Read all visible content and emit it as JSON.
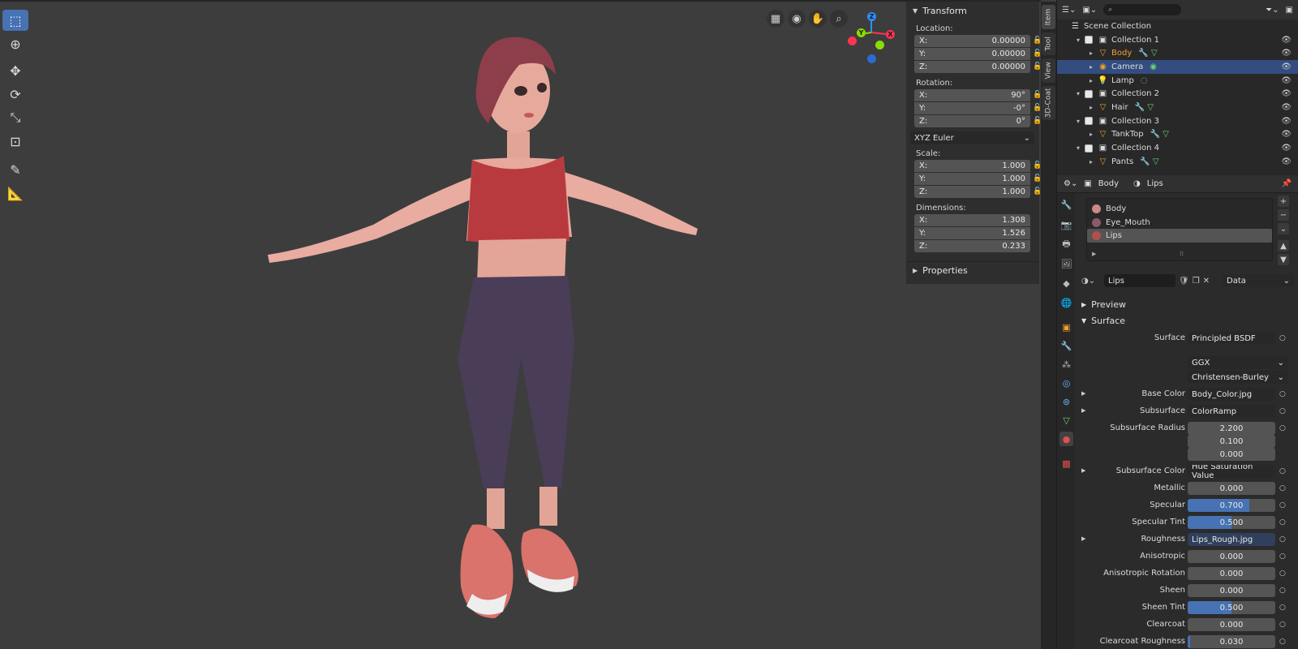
{
  "viewport": {
    "tools": [
      "select-box-icon",
      "cursor-icon",
      "move-icon",
      "rotate-icon",
      "scale-icon",
      "transform-icon",
      "annotate-icon",
      "measure-icon"
    ],
    "nav_icons": [
      "grid-icon",
      "camera-view-icon",
      "hand-pan-icon",
      "zoom-icon"
    ],
    "gizmo": {
      "z": "Z",
      "y": "Y",
      "x": "X"
    }
  },
  "npanel": {
    "transform_title": "Transform",
    "location_label": "Location:",
    "location": [
      {
        "axis": "X:",
        "value": "0.00000"
      },
      {
        "axis": "Y:",
        "value": "0.00000"
      },
      {
        "axis": "Z:",
        "value": "0.00000"
      }
    ],
    "rotation_label": "Rotation:",
    "rotation": [
      {
        "axis": "X:",
        "value": "90°"
      },
      {
        "axis": "Y:",
        "value": "-0°"
      },
      {
        "axis": "Z:",
        "value": "0°"
      }
    ],
    "rotation_mode": "XYZ Euler",
    "scale_label": "Scale:",
    "scale": [
      {
        "axis": "X:",
        "value": "1.000"
      },
      {
        "axis": "Y:",
        "value": "1.000"
      },
      {
        "axis": "Z:",
        "value": "1.000"
      }
    ],
    "dimensions_label": "Dimensions:",
    "dimensions": [
      {
        "axis": "X:",
        "value": "1.308"
      },
      {
        "axis": "Y:",
        "value": "1.526"
      },
      {
        "axis": "Z:",
        "value": "0.233"
      }
    ],
    "properties_title": "Properties"
  },
  "side_tabs": [
    "Item",
    "Tool",
    "View",
    "3D-Coat"
  ],
  "outliner": {
    "search_placeholder": "",
    "rows": [
      {
        "label": "Scene Collection",
        "type": "scene"
      },
      {
        "label": "Collection 1",
        "type": "collection"
      },
      {
        "label": "Body",
        "type": "mesh",
        "highlight": true
      },
      {
        "label": "Camera",
        "type": "camera",
        "selected": true
      },
      {
        "label": "Lamp",
        "type": "light"
      },
      {
        "label": "Collection 2",
        "type": "collection"
      },
      {
        "label": "Hair",
        "type": "mesh"
      },
      {
        "label": "Collection 3",
        "type": "collection"
      },
      {
        "label": "TankTop",
        "type": "mesh"
      },
      {
        "label": "Collection 4",
        "type": "collection"
      },
      {
        "label": "Pants",
        "type": "mesh"
      }
    ]
  },
  "properties": {
    "breadcrumb_object": "Body",
    "breadcrumb_material": "Lips",
    "materials": [
      {
        "name": "Body",
        "color": "#c98a8a"
      },
      {
        "name": "Eye_Mouth",
        "color": "#8a5a6a"
      },
      {
        "name": "Lips",
        "color": "#b05050",
        "selected": true
      }
    ],
    "material_name": "Lips",
    "link_mode": "Data",
    "preview_label": "Preview",
    "surface_label": "Surface",
    "params": [
      {
        "label": "Surface",
        "value": "Principled BSDF",
        "kind": "link"
      },
      {
        "label": "",
        "value": "GGX",
        "kind": "dd"
      },
      {
        "label": "",
        "value": "Christensen-Burley",
        "kind": "dd"
      },
      {
        "label": "Base Color",
        "value": "Body_Color.jpg",
        "kind": "link",
        "expand": true
      },
      {
        "label": "Subsurface",
        "value": "ColorRamp",
        "kind": "link",
        "expand": true
      },
      {
        "label": "Subsurface Radius",
        "value": "2.200",
        "kind": "num"
      },
      {
        "label": "",
        "value": "0.100",
        "kind": "num"
      },
      {
        "label": "",
        "value": "0.000",
        "kind": "num"
      },
      {
        "label": "Subsurface Color",
        "value": "Hue Saturation Value",
        "kind": "link",
        "expand": true
      },
      {
        "label": "Metallic",
        "value": "0.000",
        "kind": "num",
        "fill": 0
      },
      {
        "label": "Specular",
        "value": "0.700",
        "kind": "num",
        "fill": 0.7
      },
      {
        "label": "Specular Tint",
        "value": "0.500",
        "kind": "num",
        "fill": 0.5
      },
      {
        "label": "Roughness",
        "value": "Lips_Rough.jpg",
        "kind": "link",
        "expand": true
      },
      {
        "label": "Anisotropic",
        "value": "0.000",
        "kind": "num",
        "fill": 0
      },
      {
        "label": "Anisotropic Rotation",
        "value": "0.000",
        "kind": "num",
        "fill": 0
      },
      {
        "label": "Sheen",
        "value": "0.000",
        "kind": "num",
        "fill": 0
      },
      {
        "label": "Sheen Tint",
        "value": "0.500",
        "kind": "num",
        "fill": 0.5
      },
      {
        "label": "Clearcoat",
        "value": "0.000",
        "kind": "num",
        "fill": 0
      },
      {
        "label": "Clearcoat Roughness",
        "value": "0.030",
        "kind": "num",
        "fill": 0.03
      }
    ]
  },
  "colors": {
    "accent": "#4772b3",
    "selected_row": "#334d80",
    "body_highlight": "#f0a030"
  }
}
